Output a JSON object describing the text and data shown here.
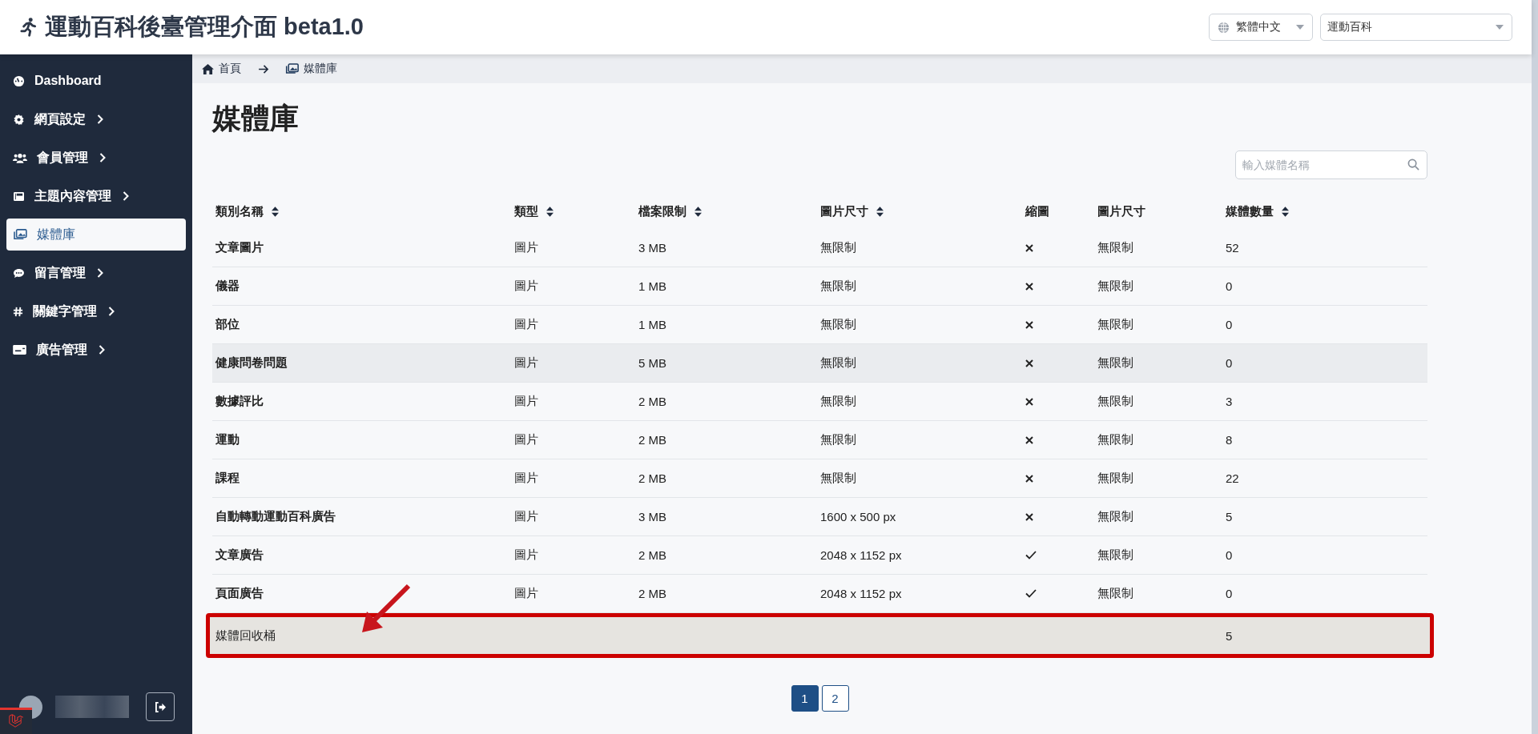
{
  "header": {
    "title": "運動百科後臺管理介面 beta1.0",
    "language_select": "繁體中文",
    "site_select": "運動百科"
  },
  "sidebar": {
    "items": [
      {
        "label": "Dashboard",
        "expandable": false,
        "selected": false
      },
      {
        "label": "網頁設定",
        "expandable": true,
        "selected": false
      },
      {
        "label": "會員管理",
        "expandable": true,
        "selected": false
      },
      {
        "label": "主題內容管理",
        "expandable": true,
        "selected": false
      },
      {
        "label": "媒體庫",
        "expandable": false,
        "selected": true
      },
      {
        "label": "留言管理",
        "expandable": true,
        "selected": false
      },
      {
        "label": "關鍵字管理",
        "expandable": true,
        "selected": false
      },
      {
        "label": "廣告管理",
        "expandable": true,
        "selected": false
      }
    ]
  },
  "breadcrumb": [
    "首頁",
    "媒體庫"
  ],
  "page_title": "媒體庫",
  "search": {
    "placeholder": "輸入媒體名稱"
  },
  "table": {
    "columns": [
      {
        "label": "類別名稱",
        "sortable": true
      },
      {
        "label": "類型",
        "sortable": true
      },
      {
        "label": "檔案限制",
        "sortable": true
      },
      {
        "label": "圖片尺寸",
        "sortable": true
      },
      {
        "label": "縮圖",
        "sortable": false
      },
      {
        "label": "圖片尺寸",
        "sortable": false
      },
      {
        "label": "媒體數量",
        "sortable": true
      }
    ],
    "rows": [
      {
        "name": "文章圖片",
        "type": "圖片",
        "limit": "3 MB",
        "size": "無限制",
        "thumbnail": false,
        "thumb_size": "無限制",
        "count": "52",
        "hovered": false,
        "highlighted": false
      },
      {
        "name": "儀器",
        "type": "圖片",
        "limit": "1 MB",
        "size": "無限制",
        "thumbnail": false,
        "thumb_size": "無限制",
        "count": "0",
        "hovered": false,
        "highlighted": false
      },
      {
        "name": "部位",
        "type": "圖片",
        "limit": "1 MB",
        "size": "無限制",
        "thumbnail": false,
        "thumb_size": "無限制",
        "count": "0",
        "hovered": false,
        "highlighted": false
      },
      {
        "name": "健康問卷問題",
        "type": "圖片",
        "limit": "5 MB",
        "size": "無限制",
        "thumbnail": false,
        "thumb_size": "無限制",
        "count": "0",
        "hovered": true,
        "highlighted": false
      },
      {
        "name": "數據評比",
        "type": "圖片",
        "limit": "2 MB",
        "size": "無限制",
        "thumbnail": false,
        "thumb_size": "無限制",
        "count": "3",
        "hovered": false,
        "highlighted": false
      },
      {
        "name": "運動",
        "type": "圖片",
        "limit": "2 MB",
        "size": "無限制",
        "thumbnail": false,
        "thumb_size": "無限制",
        "count": "8",
        "hovered": false,
        "highlighted": false
      },
      {
        "name": "課程",
        "type": "圖片",
        "limit": "2 MB",
        "size": "無限制",
        "thumbnail": false,
        "thumb_size": "無限制",
        "count": "22",
        "hovered": false,
        "highlighted": false
      },
      {
        "name": "自動轉動運動百科廣告",
        "type": "圖片",
        "limit": "3 MB",
        "size": "1600 x 500 px",
        "thumbnail": false,
        "thumb_size": "無限制",
        "count": "5",
        "hovered": false,
        "highlighted": false
      },
      {
        "name": "文章廣告",
        "type": "圖片",
        "limit": "2 MB",
        "size": "2048 x 1152 px",
        "thumbnail": true,
        "thumb_size": "無限制",
        "count": "0",
        "hovered": false,
        "highlighted": false
      },
      {
        "name": "頁面廣告",
        "type": "圖片",
        "limit": "2 MB",
        "size": "2048 x 1152 px",
        "thumbnail": true,
        "thumb_size": "無限制",
        "count": "0",
        "hovered": false,
        "highlighted": false
      },
      {
        "name": "媒體回收桶",
        "count": "5",
        "hovered": false,
        "highlighted": true
      }
    ]
  },
  "pagination": [
    {
      "label": "1",
      "selected": true
    },
    {
      "label": "2",
      "selected": false
    }
  ]
}
